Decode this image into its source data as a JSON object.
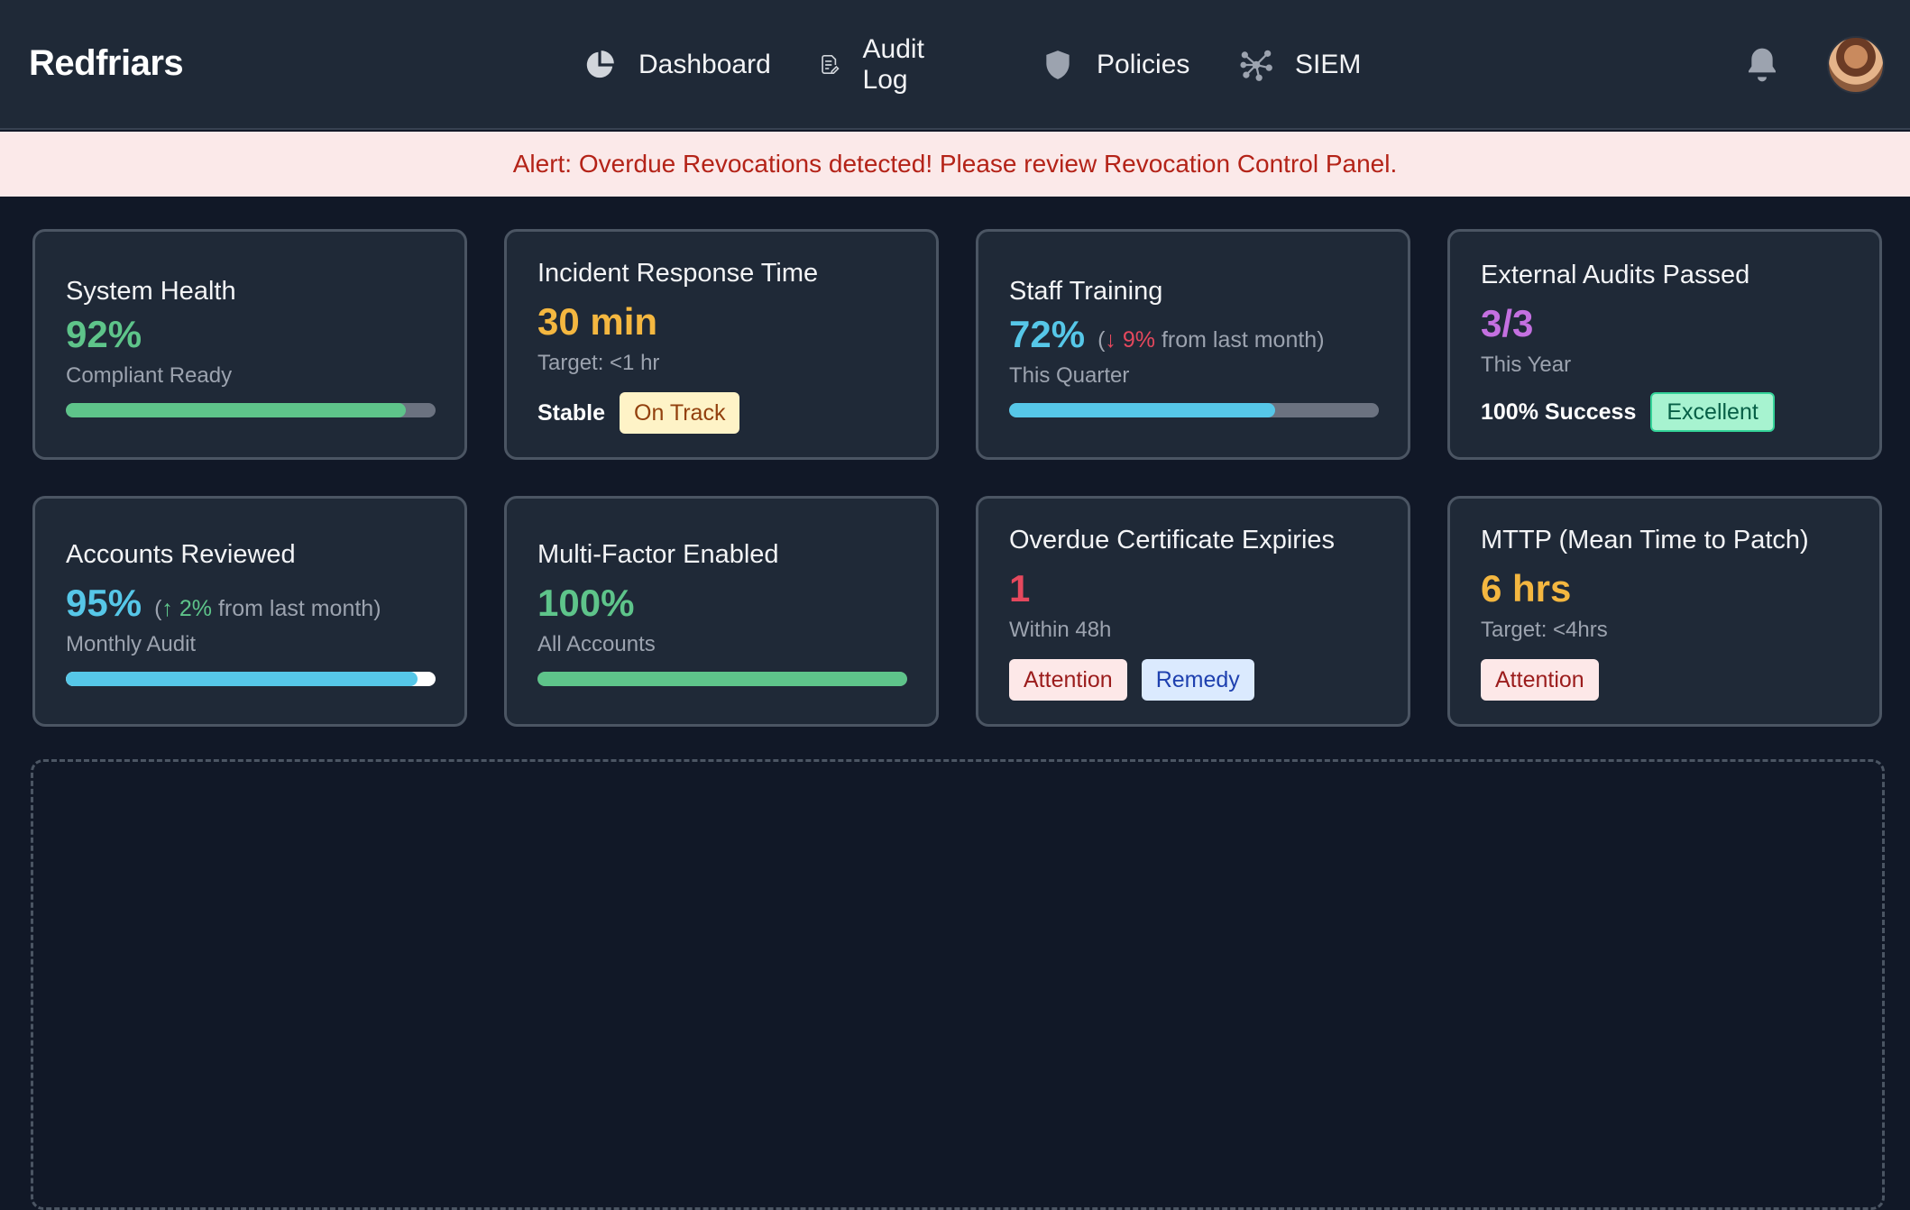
{
  "header": {
    "brand": "Redfriars",
    "nav": [
      {
        "label": "Dashboard",
        "icon": "pie-chart-icon"
      },
      {
        "label": "Audit Log",
        "icon": "document-edit-icon"
      },
      {
        "label": "Policies",
        "icon": "shield-icon"
      },
      {
        "label": "SIEM",
        "icon": "network-icon"
      }
    ],
    "bell_icon": "bell-icon",
    "avatar": "user-avatar"
  },
  "alert": {
    "text": "Alert: Overdue Revocations detected! Please review Revocation Control Panel."
  },
  "colors": {
    "green": "#5ec48a",
    "yellow": "#f4b740",
    "cyan": "#56c7e8",
    "purple": "#c470e0",
    "red": "#e5485d"
  },
  "cards": {
    "system_health": {
      "title": "System Health",
      "value": "92%",
      "sub": "Compliant Ready",
      "progress": 0.92
    },
    "incident_response": {
      "title": "Incident Response Time",
      "value": "30 min",
      "sub": "Target: <1 hr",
      "status_label": "Stable",
      "badge": "On Track"
    },
    "staff_training": {
      "title": "Staff Training",
      "value": "72%",
      "delta_arrow": "↓",
      "delta_value": "9%",
      "delta_text": "from last month)",
      "delta_open": "(",
      "sub": "This Quarter",
      "progress": 0.72
    },
    "external_audits": {
      "title": "External Audits Passed",
      "value": "3/3",
      "sub": "This Year",
      "status_label": "100% Success",
      "badge": "Excellent"
    },
    "accounts_reviewed": {
      "title": "Accounts Reviewed",
      "value": "95%",
      "delta_arrow": "↑",
      "delta_value": "2%",
      "delta_text": "from last month)",
      "delta_open": "(",
      "sub": "Monthly Audit",
      "progress": 0.95
    },
    "mfa": {
      "title": "Multi-Factor Enabled",
      "value": "100%",
      "sub": "All Accounts",
      "progress": 1.0
    },
    "overdue_certs": {
      "title": "Overdue Certificate Expiries",
      "value": "1",
      "sub": "Within 48h",
      "badge_1": "Attention",
      "badge_2": "Remedy"
    },
    "mttp": {
      "title": "MTTP (Mean Time to Patch)",
      "value": "6 hrs",
      "sub": "Target: <4hrs",
      "badge": "Attention"
    }
  }
}
